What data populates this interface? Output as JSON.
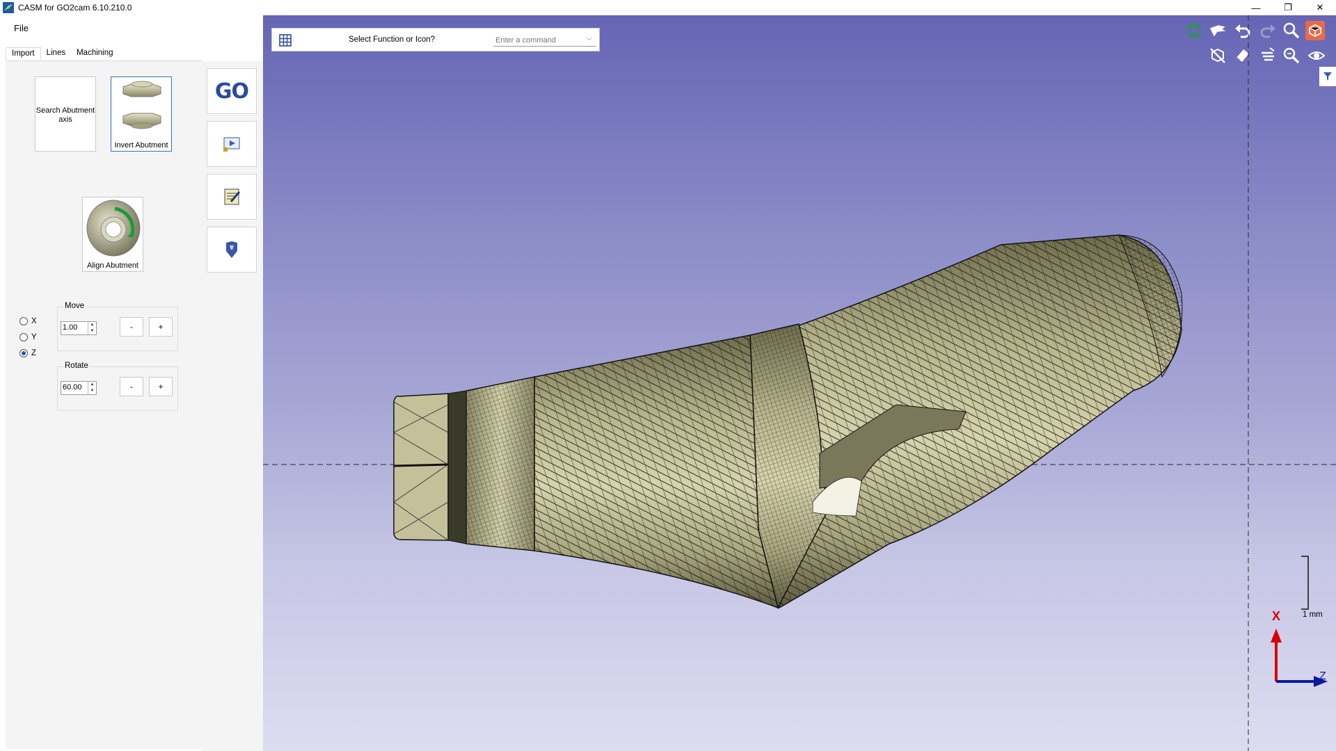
{
  "window": {
    "title": "CASM for GO2cam 6.10.210.0",
    "minimize": "—",
    "maximize": "❐",
    "close": "✕"
  },
  "menu": {
    "file": "File"
  },
  "tabs": [
    "Import",
    "Lines",
    "Machining"
  ],
  "import_panel": {
    "search_label": "Search Abutment axis",
    "invert_label": "Invert Abutment",
    "align_label": "Align Abutment",
    "axes": [
      {
        "label": "X",
        "selected": false
      },
      {
        "label": "Y",
        "selected": false
      },
      {
        "label": "Z",
        "selected": true
      }
    ],
    "move": {
      "title": "Move",
      "value": "1.00",
      "minus": "-",
      "plus": "+"
    },
    "rotate": {
      "title": "Rotate",
      "value": "60.00",
      "minus": "-",
      "plus": "+"
    }
  },
  "sidebar": {
    "go_label": "GO"
  },
  "command": {
    "label": "Select Function or Icon?",
    "placeholder": "Enter a command"
  },
  "viewport": {
    "scale_label": "1 mm",
    "axis_x": "X",
    "axis_z": "Z",
    "toolbar_icons": [
      "refresh-icon",
      "pointer-icon",
      "undo-icon",
      "redo-icon",
      "zoom-icon",
      "render-mode-icon",
      "hide-icon",
      "eraser-icon",
      "layers-icon",
      "zoom-window-icon",
      "visibility-icon",
      "filter-icon"
    ]
  },
  "colors": {
    "viewport_top": "#6565b5",
    "viewport_bottom": "#dcdcf1",
    "model_fill": "#b8b48c",
    "axis_x": "#e00000",
    "axis_z": "#0a1aa0",
    "accent": "#2a73c9"
  }
}
